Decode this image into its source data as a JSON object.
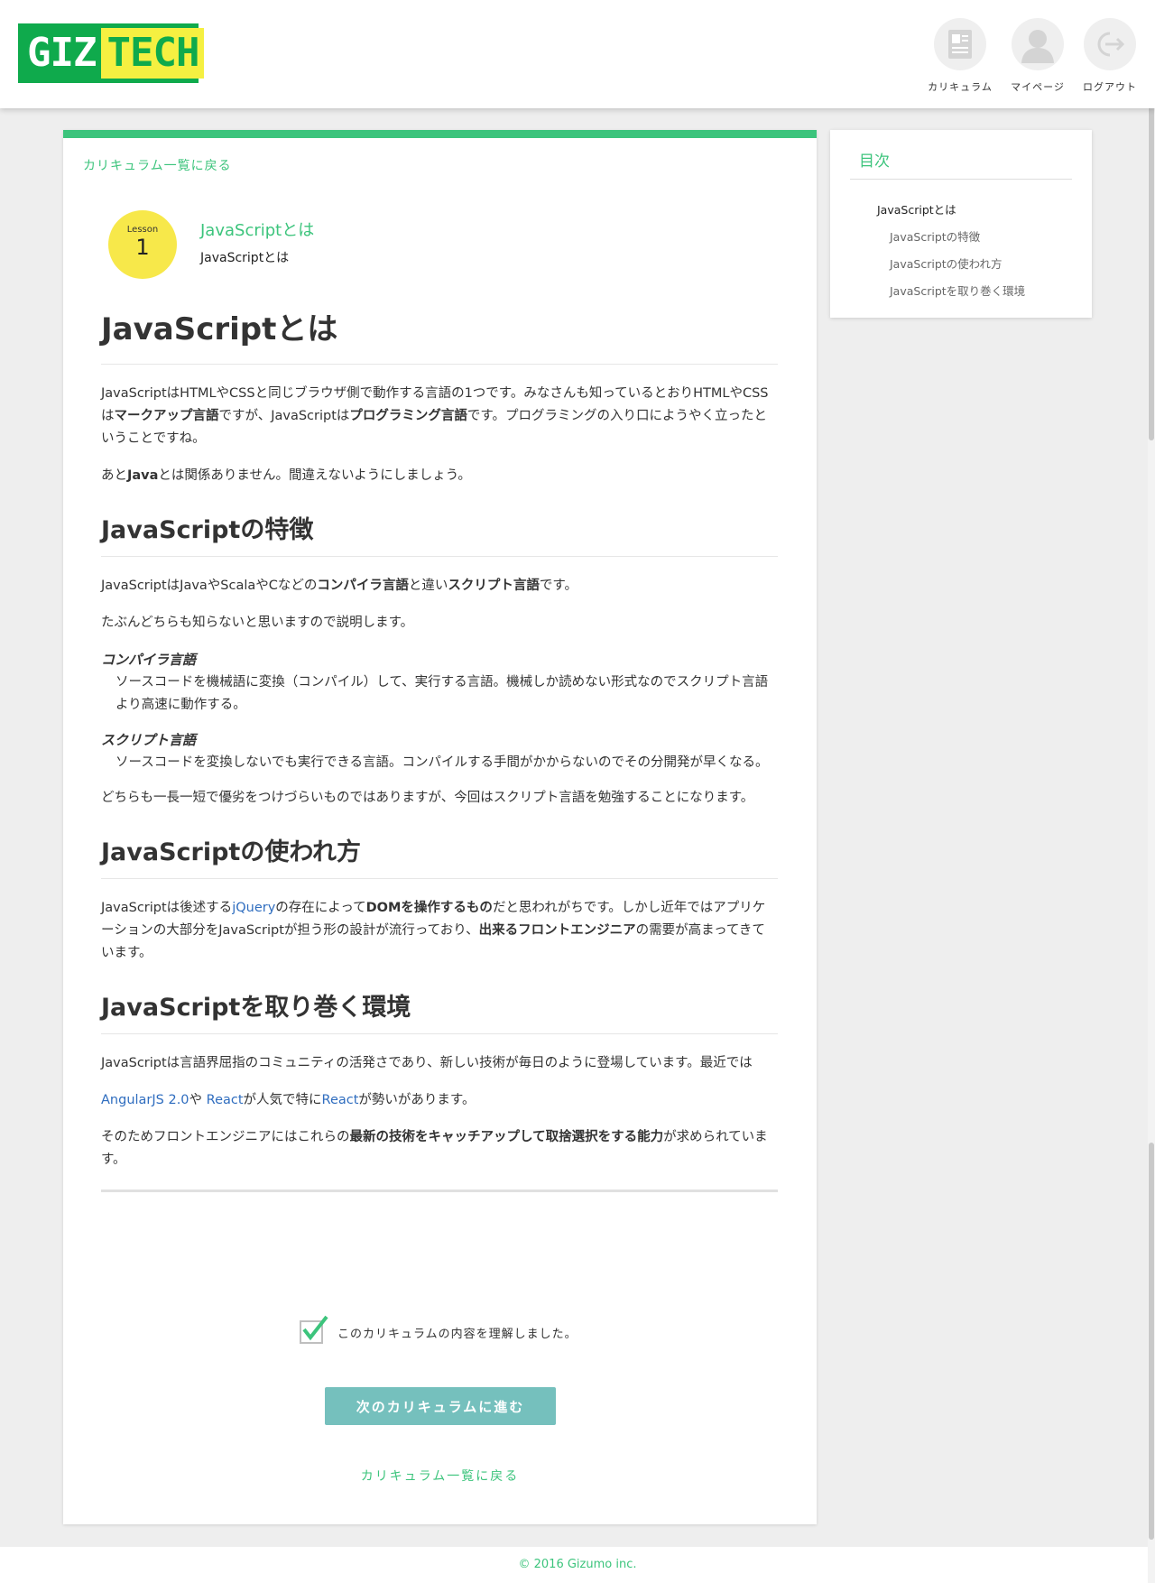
{
  "header": {
    "logo": {
      "giz": "GIZ",
      "tech": "TECH"
    },
    "nav": [
      {
        "label": "カリキュラム",
        "icon": "curriculum-icon"
      },
      {
        "label": "マイページ",
        "icon": "user-icon"
      },
      {
        "label": "ログアウト",
        "icon": "logout-icon"
      }
    ]
  },
  "colors": {
    "accent": "#3cc47c",
    "logo_green": "#0faa4c",
    "logo_yellow": "#f5f041",
    "badge_yellow": "#f7e84a",
    "button": "#75c0bd",
    "link": "#2f6dbf"
  },
  "main": {
    "back_link": "カリキュラム一覧に戻る",
    "lesson": {
      "word": "Lesson",
      "number": "1",
      "title": "JavaScriptとは",
      "subtitle": "JavaScriptとは"
    },
    "sections": {
      "intro": {
        "heading": "JavaScriptとは",
        "p1": [
          "JavaScriptはHTMLやCSSと同じブラウザ側で動作する言語の1つです。みなさんも知っているとおりHTMLやCSSは",
          "マークアップ言語",
          "ですが、JavaScriptは",
          "プログラミング言語",
          "です。プログラミングの入り口にようやく立ったということですね。"
        ],
        "p2": [
          "あと",
          "Java",
          "とは関係ありません。間違えないようにしましょう。"
        ]
      },
      "features": {
        "heading": "JavaScriptの特徴",
        "p1": [
          "JavaScriptはJavaやScalaやCなどの",
          "コンパイラ言語",
          "と違い",
          "スクリプト言語",
          "です。"
        ],
        "p2": "たぶんどちらも知らないと思いますので説明します。",
        "compiler_term": "コンパイラ言語",
        "compiler_def": "ソースコードを機械語に変換（コンパイル）して、実行する言語。機械しか読めない形式なのでスクリプト言語より高速に動作する。",
        "script_term": "スクリプト言語",
        "script_def": "ソースコードを変換しないでも実行できる言語。コンパイルする手間がかからないのでその分開発が早くなる。",
        "p3": "どちらも一長一短で優劣をつけづらいものではありますが、今回はスクリプト言語を勉強することになります。"
      },
      "usage": {
        "heading": "JavaScriptの使われ方",
        "p1": [
          "JavaScriptは後述する",
          "jQuery",
          "の存在によって",
          "DOMを操作するもの",
          "だと思われがちです。しかし近年ではアプリケーションの大部分をJavaScriptが担う形の設計が流行っており、",
          "出来るフロントエンジニア",
          "の需要が高まってきています。"
        ]
      },
      "environment": {
        "heading": "JavaScriptを取り巻く環境",
        "p1": "JavaScriptは言語界屈指のコミュニティの活発さであり、新しい技術が毎日のように登場しています。最近では",
        "p2": [
          "AngularJS 2.0",
          "や ",
          "React",
          "が人気で特に",
          "React",
          "が勢いがあります。"
        ],
        "p3": [
          "そのためフロントエンジニアにはこれらの",
          "最新の技術をキャッチアップして取捨選択をする能力",
          "が求められています。"
        ]
      }
    },
    "confirm_label": "このカリキュラムの内容を理解しました。",
    "confirm_checked": true,
    "next_button": "次のカリキュラムに進む",
    "back_link_bottom": "カリキュラム一覧に戻る"
  },
  "toc": {
    "title": "目次",
    "items": [
      "JavaScriptとは",
      "JavaScriptの特徴",
      "JavaScriptの使われ方",
      "JavaScriptを取り巻く環境"
    ]
  },
  "footer": {
    "copyright": "© 2016 Gizumo inc."
  }
}
